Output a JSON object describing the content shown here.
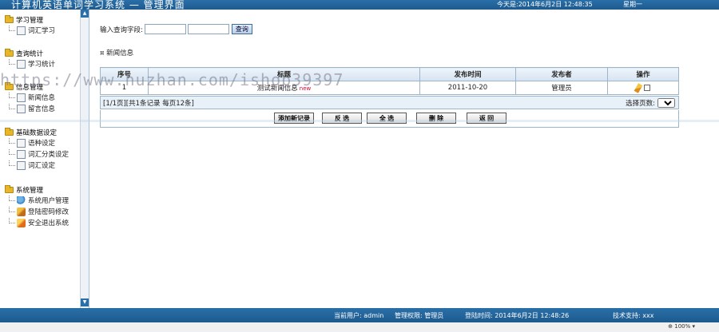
{
  "header": {
    "title": "计算机英语单词学习系统 — 管理界面",
    "date": "今天是:2014年6月2日 12:48:35",
    "week": "星期一"
  },
  "sidebar": {
    "groups": [
      {
        "title": "学习管理",
        "items": [
          "词汇学习"
        ]
      },
      {
        "title": "查询统计",
        "items": [
          "学习统计"
        ]
      },
      {
        "title": "信息管理",
        "items": [
          "新闻信息",
          "留言信息"
        ]
      },
      {
        "title": "基础数据设定",
        "items": [
          "语种设定",
          "词汇分类设定",
          "词汇设定"
        ]
      },
      {
        "title": "系统管理",
        "items": [
          "系统用户管理",
          "登陆密码修改",
          "安全退出系统"
        ]
      }
    ]
  },
  "search": {
    "label": "输入查询字段:",
    "button": "查询"
  },
  "section": {
    "title": "新闻信息"
  },
  "table": {
    "headers": [
      "序号",
      "标题",
      "发布时间",
      "发布者",
      "操作"
    ],
    "rows": [
      {
        "index": "1",
        "title": "测试新闻信息",
        "badge": "new",
        "date": "2011-10-20",
        "author": "管理员"
      }
    ]
  },
  "pager": {
    "info": "[1/1页][共1条记录 每页12条]",
    "jump_label": "选择页数:",
    "page_selected": "1"
  },
  "actions": {
    "add": "添加新记录",
    "invert": "反 选",
    "all": "全 选",
    "delete": "删 除",
    "back": "返 回"
  },
  "watermark": "https://www.huzhan.com/ishop39397",
  "footer": {
    "user": "当前用户: admin",
    "role": "管理权限: 管理员",
    "login_time": "登陆时间: 2014年6月2日 12:48:26",
    "support": "技术支持: xxx"
  },
  "statusbar": {
    "zoom": "100%"
  }
}
